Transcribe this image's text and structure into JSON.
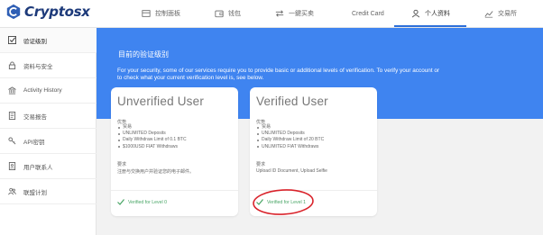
{
  "brand": {
    "name": "Cryptosx"
  },
  "nav": [
    {
      "label": "控制面板",
      "icon": "dashboard-icon"
    },
    {
      "label": "钱包",
      "icon": "wallet-icon"
    },
    {
      "label": "一鍵买卖",
      "icon": "swap-arrows-icon"
    },
    {
      "label": "Credit Card",
      "icon": ""
    },
    {
      "label": "个人资料",
      "icon": "user-icon",
      "active": true
    },
    {
      "label": "交易所",
      "icon": "chart-icon"
    }
  ],
  "sidebar": {
    "items": [
      {
        "label": "验证级别",
        "icon": "checkbox-icon",
        "active": true
      },
      {
        "label": "资料与安全",
        "icon": "lock-icon"
      },
      {
        "label": "Activity History",
        "icon": "bank-icon"
      },
      {
        "label": "交易报告",
        "icon": "document-icon"
      },
      {
        "label": "API密钥",
        "icon": "key-icon"
      },
      {
        "label": "用户联系人",
        "icon": "contacts-icon"
      },
      {
        "label": "联盟计划",
        "icon": "people-icon"
      }
    ]
  },
  "banner": {
    "title": "目前的验证级别",
    "description": "For your security, some of our services require you to provide basic or additional levels of verification. To verify your account or to check what your current verification level is, see below."
  },
  "cards": [
    {
      "title": "Unverified User",
      "benefits_label": "优势",
      "benefits": [
        "贸易",
        "UNLIMITED Deposits",
        "Daily Withdraw Limit of 0.1 BTC",
        "$1000USD FIAT Withdraws"
      ],
      "requirements_label": "要求",
      "requirements": "注册与交换用户并验证您的电子邮件。",
      "status": "Verified for Level 0"
    },
    {
      "title": "Verified User",
      "benefits_label": "优势",
      "benefits": [
        "贸易",
        "UNLIMITED Deposits",
        "Daily Withdraw Limit of 20 BTC",
        "UNLIMITED FIAT Withdraws"
      ],
      "requirements_label": "要求",
      "requirements": "Upload ID Document, Upload Selfie",
      "status": "Verified for Level 1"
    }
  ],
  "colors": {
    "accent": "#3f84f0",
    "success": "#48a565",
    "annotation": "#d9232b",
    "brand": "#1d3a7a"
  }
}
